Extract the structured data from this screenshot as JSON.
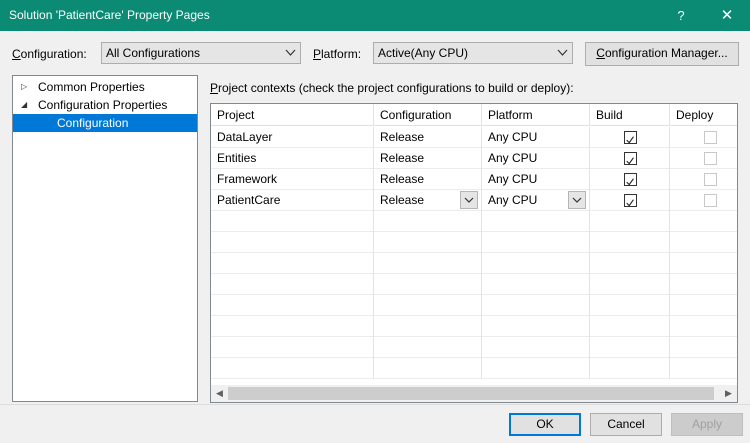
{
  "window": {
    "title": "Solution 'PatientCare' Property Pages",
    "help_label": "?",
    "close_label": "✕",
    "accent_color": "#0b8a74"
  },
  "toolbar": {
    "configuration_label_pre": "C",
    "configuration_label_rest": "onfiguration:",
    "configuration_value": "All Configurations",
    "platform_label_pre": "P",
    "platform_label_rest": "latform:",
    "platform_value": "Active(Any CPU)",
    "config_manager_pre": "C",
    "config_manager_rest": "onfiguration Manager..."
  },
  "tree": {
    "items": [
      {
        "label": "Common Properties",
        "toggle": "▷"
      },
      {
        "label": "Configuration Properties",
        "toggle": "◢"
      },
      {
        "label": "Configuration",
        "toggle": ""
      }
    ]
  },
  "contexts": {
    "caption_pre": "P",
    "caption_rest": "roject contexts (check the project configurations to build or deploy):",
    "columns": [
      "Project",
      "Configuration",
      "Platform",
      "Build",
      "Deploy"
    ],
    "rows": [
      {
        "project": "DataLayer",
        "configuration": "Release",
        "platform": "Any CPU",
        "build": true,
        "deploy": false
      },
      {
        "project": "Entities",
        "configuration": "Release",
        "platform": "Any CPU",
        "build": true,
        "deploy": false
      },
      {
        "project": "Framework",
        "configuration": "Release",
        "platform": "Any CPU",
        "build": true,
        "deploy": false
      },
      {
        "project": "PatientCare",
        "configuration": "Release",
        "platform": "Any CPU",
        "build": true,
        "deploy": false
      }
    ]
  },
  "footer": {
    "ok_label": "OK",
    "cancel_label": "Cancel",
    "apply_label": "Apply"
  }
}
